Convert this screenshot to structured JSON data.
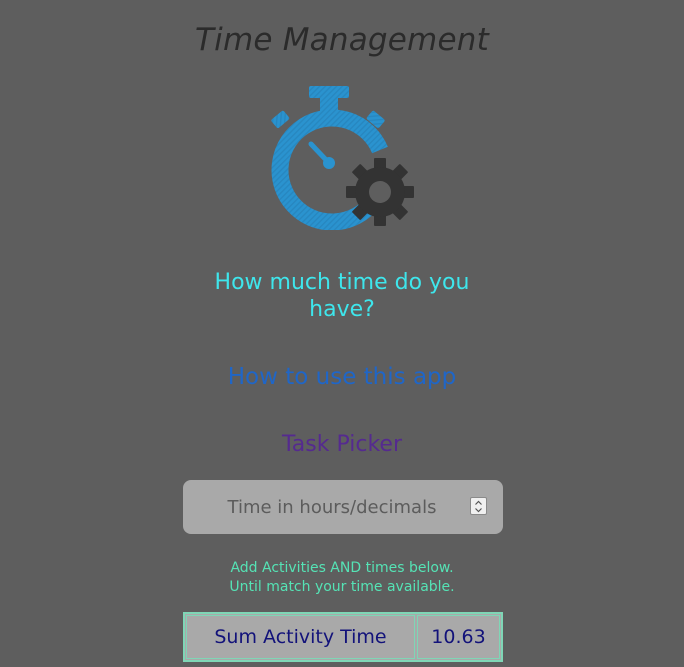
{
  "header": {
    "title": "Time Management"
  },
  "logo": {
    "icon": "stopwatch-gear-icon",
    "colors": {
      "stopwatch": "#2a93cf",
      "gear": "#333333"
    }
  },
  "main": {
    "question": "How much time do you have?",
    "how_to_link": "How to use this app",
    "task_picker_link": "Task Picker",
    "time_input": {
      "placeholder": "Time in hours/decimals",
      "value": ""
    },
    "hint_line1": "Add Activities AND times below.",
    "hint_line2": "Until match your time available.",
    "sum": {
      "label": "Sum Activity Time",
      "value": "10.63"
    }
  },
  "colors": {
    "background": "#5e5e5e",
    "question": "#3ee6ec",
    "link": "#1f66c8",
    "task_picker": "#552a8f",
    "hint": "#55e3b5",
    "sum_text": "#12127a",
    "panel": "#a9a9a9"
  }
}
